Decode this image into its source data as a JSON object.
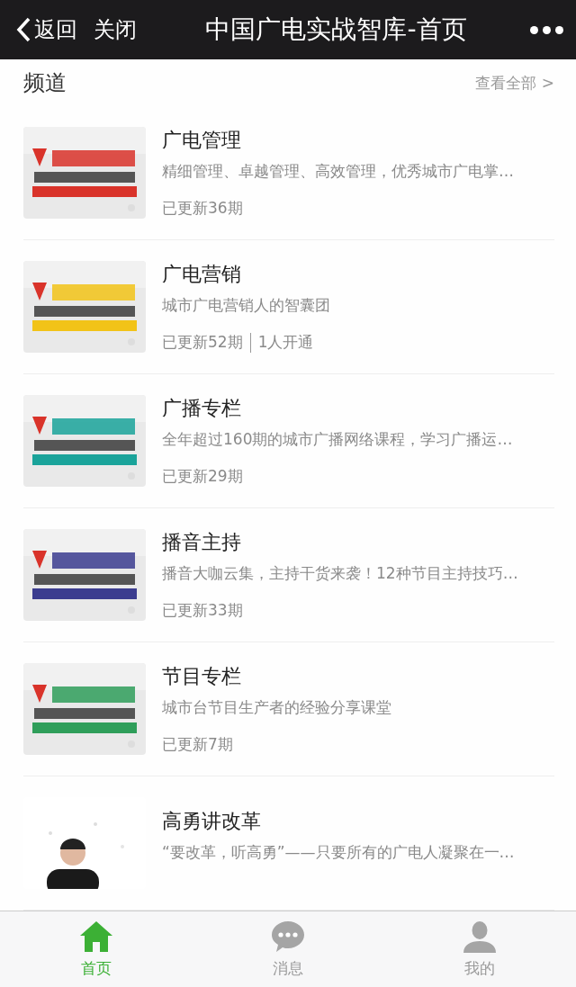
{
  "nav": {
    "back": "返回",
    "close": "关闭",
    "title": "中国广电实战智库-首页"
  },
  "section": {
    "title": "频道",
    "more": "查看全部 >"
  },
  "channels": [
    {
      "name": "广电管理",
      "description": "精细管理、卓越管理、高效管理，优秀城市广电掌…",
      "meta": [
        "已更新36期"
      ]
    },
    {
      "name": "广电营销",
      "description": "城市广电营销人的智囊团",
      "meta": [
        "已更新52期",
        "1人开通"
      ]
    },
    {
      "name": "广播专栏",
      "description": "全年超过160期的城市广播网络课程，学习广播运…",
      "meta": [
        "已更新29期"
      ]
    },
    {
      "name": "播音主持",
      "description": "播音大咖云集，主持干货来袭！12种节目主持技巧…",
      "meta": [
        "已更新33期"
      ]
    },
    {
      "name": "节目专栏",
      "description": "城市台节目生产者的经验分享课堂",
      "meta": [
        "已更新7期"
      ]
    },
    {
      "name": "高勇讲改革",
      "description": "“要改革，听高勇”——只要所有的广电人凝聚在一…"
    }
  ],
  "tabs": [
    {
      "label": "首页",
      "kind": "home",
      "selected": true
    },
    {
      "label": "消息",
      "kind": "messages",
      "selected": false
    },
    {
      "label": "我的",
      "kind": "profile",
      "selected": false
    }
  ]
}
